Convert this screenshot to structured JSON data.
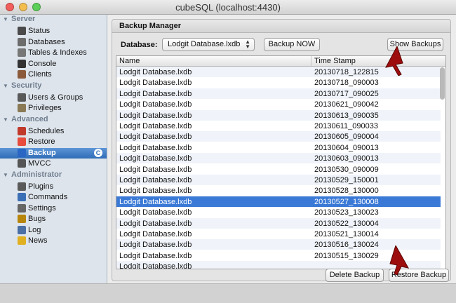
{
  "window": {
    "title": "cubeSQL (localhost:4430)"
  },
  "sidebar": {
    "sections": [
      {
        "label": "Server",
        "items": [
          {
            "label": "Status",
            "icon": "status-icon",
            "color": "#4a4a4a"
          },
          {
            "label": "Databases",
            "icon": "databases-icon",
            "color": "#6c6c6c"
          },
          {
            "label": "Tables & Indexes",
            "icon": "tables-icon",
            "color": "#777777"
          },
          {
            "label": "Console",
            "icon": "console-icon",
            "color": "#333333"
          },
          {
            "label": "Clients",
            "icon": "clients-icon",
            "color": "#8a5a3a"
          }
        ]
      },
      {
        "label": "Security",
        "items": [
          {
            "label": "Users & Groups",
            "icon": "users-icon",
            "color": "#5a5a5a"
          },
          {
            "label": "Privileges",
            "icon": "privileges-icon",
            "color": "#8a7a55"
          }
        ]
      },
      {
        "label": "Advanced",
        "items": [
          {
            "label": "Schedules",
            "icon": "calendar-icon",
            "color": "#c0392b"
          },
          {
            "label": "Restore",
            "icon": "lifebuoy-icon",
            "color": "#e74c3c"
          },
          {
            "label": "Backup",
            "icon": "umbrella-icon",
            "color": "#2a66c4",
            "selected": true,
            "badge": "C"
          },
          {
            "label": "MVCC",
            "icon": "mvcc-icon",
            "color": "#555555"
          }
        ]
      },
      {
        "label": "Administrator",
        "items": [
          {
            "label": "Plugins",
            "icon": "plugins-icon",
            "color": "#5a5a5a"
          },
          {
            "label": "Commands",
            "icon": "commands-icon",
            "color": "#3b6fb6"
          },
          {
            "label": "Settings",
            "icon": "settings-icon",
            "color": "#666666"
          },
          {
            "label": "Bugs",
            "icon": "bug-icon",
            "color": "#b8860b"
          },
          {
            "label": "Log",
            "icon": "log-icon",
            "color": "#4a6fa5"
          },
          {
            "label": "News",
            "icon": "news-icon",
            "color": "#e0b020"
          }
        ]
      }
    ]
  },
  "backup": {
    "panel_title": "Backup Manager",
    "database_label": "Database:",
    "database_value": "Lodgit Database.lxdb",
    "backup_now": "Backup NOW",
    "show_backups": "Show Backups",
    "delete_backup": "Delete Backup",
    "restore_backup": "Restore Backup",
    "columns": [
      "Name",
      "Time Stamp"
    ],
    "rows": [
      {
        "name": "Lodgit Database.lxdb",
        "ts": "20130718_122815"
      },
      {
        "name": "Lodgit Database.lxdb",
        "ts": "20130718_090003"
      },
      {
        "name": "Lodgit Database.lxdb",
        "ts": "20130717_090025"
      },
      {
        "name": "Lodgit Database.lxdb",
        "ts": "20130621_090042"
      },
      {
        "name": "Lodgit Database.lxdb",
        "ts": "20130613_090035"
      },
      {
        "name": "Lodgit Database.lxdb",
        "ts": "20130611_090033"
      },
      {
        "name": "Lodgit Database.lxdb",
        "ts": "20130605_090004"
      },
      {
        "name": "Lodgit Database.lxdb",
        "ts": "20130604_090013"
      },
      {
        "name": "Lodgit Database.lxdb",
        "ts": "20130603_090013"
      },
      {
        "name": "Lodgit Database.lxdb",
        "ts": "20130530_090009"
      },
      {
        "name": "Lodgit Database.lxdb",
        "ts": "20130529_150001"
      },
      {
        "name": "Lodgit Database.lxdb",
        "ts": "20130528_130000"
      },
      {
        "name": "Lodgit Database.lxdb",
        "ts": "20130527_130008",
        "selected": true
      },
      {
        "name": "Lodgit Database.lxdb",
        "ts": "20130523_130023"
      },
      {
        "name": "Lodgit Database.lxdb",
        "ts": "20130522_130004"
      },
      {
        "name": "Lodgit Database.lxdb",
        "ts": "20130521_130014"
      },
      {
        "name": "Lodgit Database.lxdb",
        "ts": "20130516_130024"
      },
      {
        "name": "Lodgit Database.lxdb",
        "ts": "20130515_130029"
      },
      {
        "name": "Lodgit Database.lxdb",
        "ts": ""
      }
    ]
  }
}
